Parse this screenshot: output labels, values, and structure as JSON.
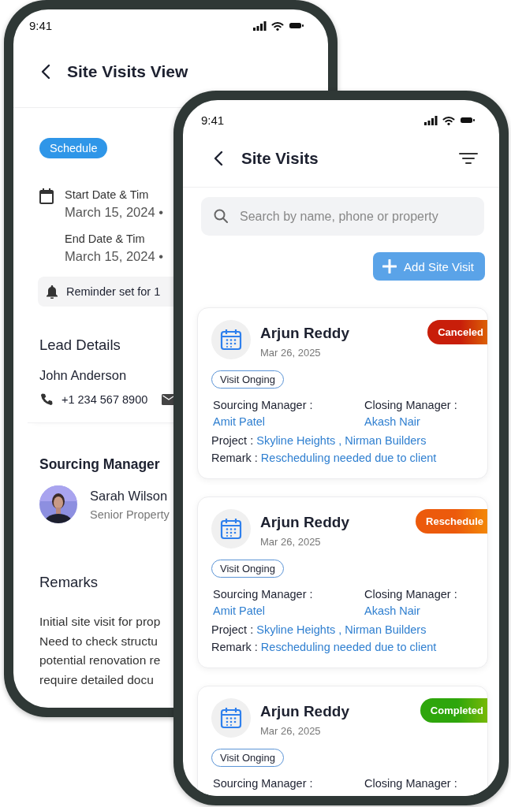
{
  "detail_screen": {
    "status_time": "9:41",
    "title": "Site Visits View",
    "status_pill": "Schedule",
    "start_label": "Start Date & Tim",
    "start_value": "March 15, 2024 •",
    "end_label": "End Date & Tim",
    "end_value": "March 15, 2024 •",
    "reminder": "Reminder set for 1",
    "lead": {
      "heading": "Lead Details",
      "name": "John Anderson",
      "phone": "+1 234 567 8900"
    },
    "sourcing": {
      "heading": "Sourcing Manager",
      "name": "Sarah Wilson",
      "role": "Senior Property"
    },
    "remarks": {
      "heading": "Remarks",
      "lines": [
        "Initial site visit for prop",
        "Need to check structu",
        "potential renovation re",
        "require detailed docu"
      ]
    }
  },
  "list_screen": {
    "status_time": "9:41",
    "title": "Site Visits",
    "search": {
      "placeholder": "Search by name, phone or property"
    },
    "add_button": "Add Site Visit",
    "visits": [
      {
        "name": "Arjun Reddy",
        "date": "Mar 26, 2025",
        "status": "Canceled",
        "color": "#c81e0a",
        "tag": "Visit Onging",
        "sourcing_label": "Sourcing Manager :",
        "sourcing_name": "Amit Patel",
        "closing_label": "Closing Manager :",
        "closing_name": "Akash Nair",
        "project_label": "Project :",
        "project": "Skyline Heights , Nirman Builders",
        "remark_label": "Remark :",
        "remark": "Rescheduling needed due to client"
      },
      {
        "name": "Arjun Reddy",
        "date": "Mar 26, 2025",
        "status": "Reschedule",
        "color": "#ec5a0c",
        "tag": "Visit Onging",
        "sourcing_label": "Sourcing Manager :",
        "sourcing_name": "Amit Patel",
        "closing_label": "Closing Manager :",
        "closing_name": "Akash Nair",
        "project_label": "Project :",
        "project": "Skyline Heights , Nirman Builders",
        "remark_label": "Remark :",
        "remark": "Rescheduling needed due to client"
      },
      {
        "name": "Arjun Reddy",
        "date": "Mar 26, 2025",
        "status": "Completed",
        "color": "#2ea60c",
        "tag": "Visit Onging",
        "sourcing_label": "Sourcing Manager :",
        "closing_label": "Closing Manager :"
      }
    ]
  }
}
